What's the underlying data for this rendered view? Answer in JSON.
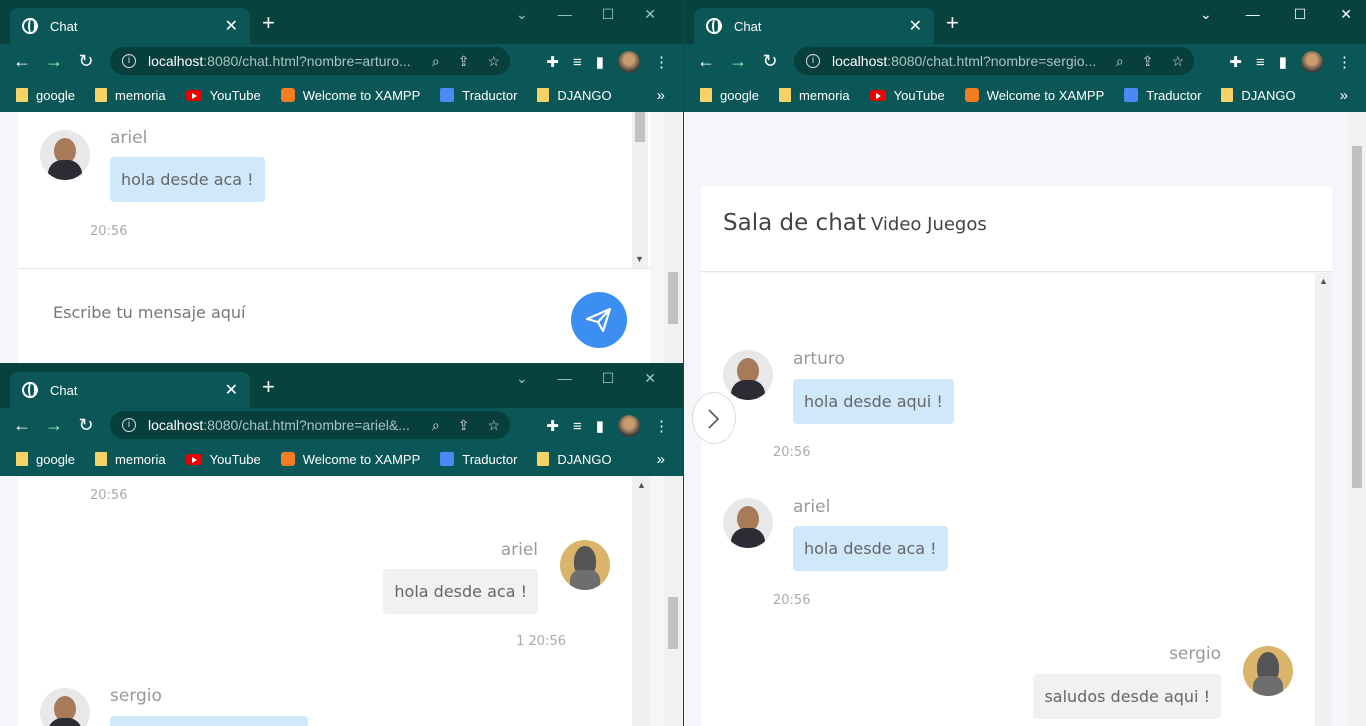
{
  "browser": {
    "tab_title": "Chat",
    "bookmarks": [
      "google",
      "memoria",
      "YouTube",
      "Welcome to XAMPP",
      "Traductor",
      "DJANGO"
    ]
  },
  "window_arturo": {
    "url_host": "localhost",
    "url_path": ":8080/chat.html?nombre=arturo...",
    "messages": [
      {
        "name": "ariel",
        "text": "hola desde aca !",
        "time": "20:56"
      }
    ],
    "input_placeholder": "Escribe tu mensaje aquí"
  },
  "window_ariel": {
    "url_host": "localhost",
    "url_path": ":8080/chat.html?nombre=ariel&...",
    "top_time": "20:56",
    "own_message": {
      "name": "ariel",
      "text": "hola desde aca !",
      "time": "1 20:56"
    },
    "next_message_name": "sergio"
  },
  "window_sergio": {
    "url_host": "localhost",
    "url_path": ":8080/chat.html?nombre=sergio...",
    "room_label": "Sala de chat",
    "room_name": "Video Juegos",
    "messages": [
      {
        "name": "arturo",
        "text": "hola desde aqui !",
        "time": "20:56"
      },
      {
        "name": "ariel",
        "text": "hola desde aca !",
        "time": "20:56"
      }
    ],
    "own_message": {
      "name": "sergio",
      "text": "saludos desde aqui !"
    }
  },
  "icons": {
    "send": "paper-plane-icon",
    "drawer": "chevron-right-icon"
  },
  "colors": {
    "chrome": "#0b5656",
    "bubble_in": "#cfe9fb",
    "bubble_out": "#f1f1f1",
    "send": "#3c8ef3"
  }
}
